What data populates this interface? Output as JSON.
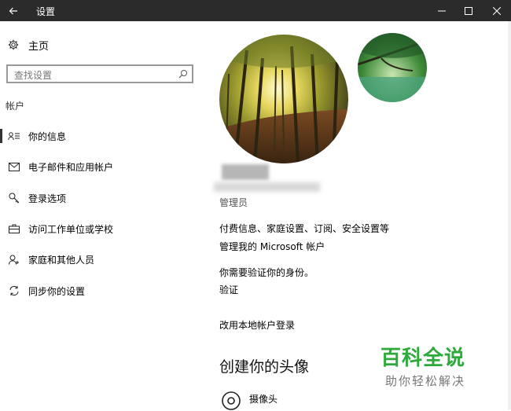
{
  "window": {
    "title": "设置",
    "icons": {
      "back": "back-arrow-icon",
      "minimize": "minimize-icon",
      "maximize": "maximize-icon",
      "close": "close-icon"
    }
  },
  "sidebar": {
    "home_label": "主页",
    "search": {
      "placeholder": "查找设置"
    },
    "section_label": "帐户",
    "items": [
      {
        "label": "你的信息",
        "icon": "person-card-icon",
        "selected": true
      },
      {
        "label": "电子邮件和应用帐户",
        "icon": "mail-icon",
        "selected": false
      },
      {
        "label": "登录选项",
        "icon": "key-icon",
        "selected": false
      },
      {
        "label": "访问工作单位或学校",
        "icon": "briefcase-icon",
        "selected": false
      },
      {
        "label": "家庭和其他人员",
        "icon": "person-add-icon",
        "selected": false
      },
      {
        "label": "同步你的设置",
        "icon": "sync-icon",
        "selected": false
      }
    ]
  },
  "main": {
    "role": "管理员",
    "links": {
      "billing": "付费信息、家庭设置、订阅、安全设置等",
      "manage_account": "管理我的 Microsoft 帐户",
      "verify_prompt": "你需要验证你的身份。",
      "verify": "验证",
      "local_login": "改用本地帐户登录"
    },
    "create_avatar_heading": "创建你的头像",
    "camera_label": "摄像头"
  },
  "watermark": {
    "title": "百科全说",
    "subtitle": "助你轻松解决"
  },
  "colors": {
    "titlebar": "#2b2b2b",
    "watermark": "#2eaa3c"
  }
}
